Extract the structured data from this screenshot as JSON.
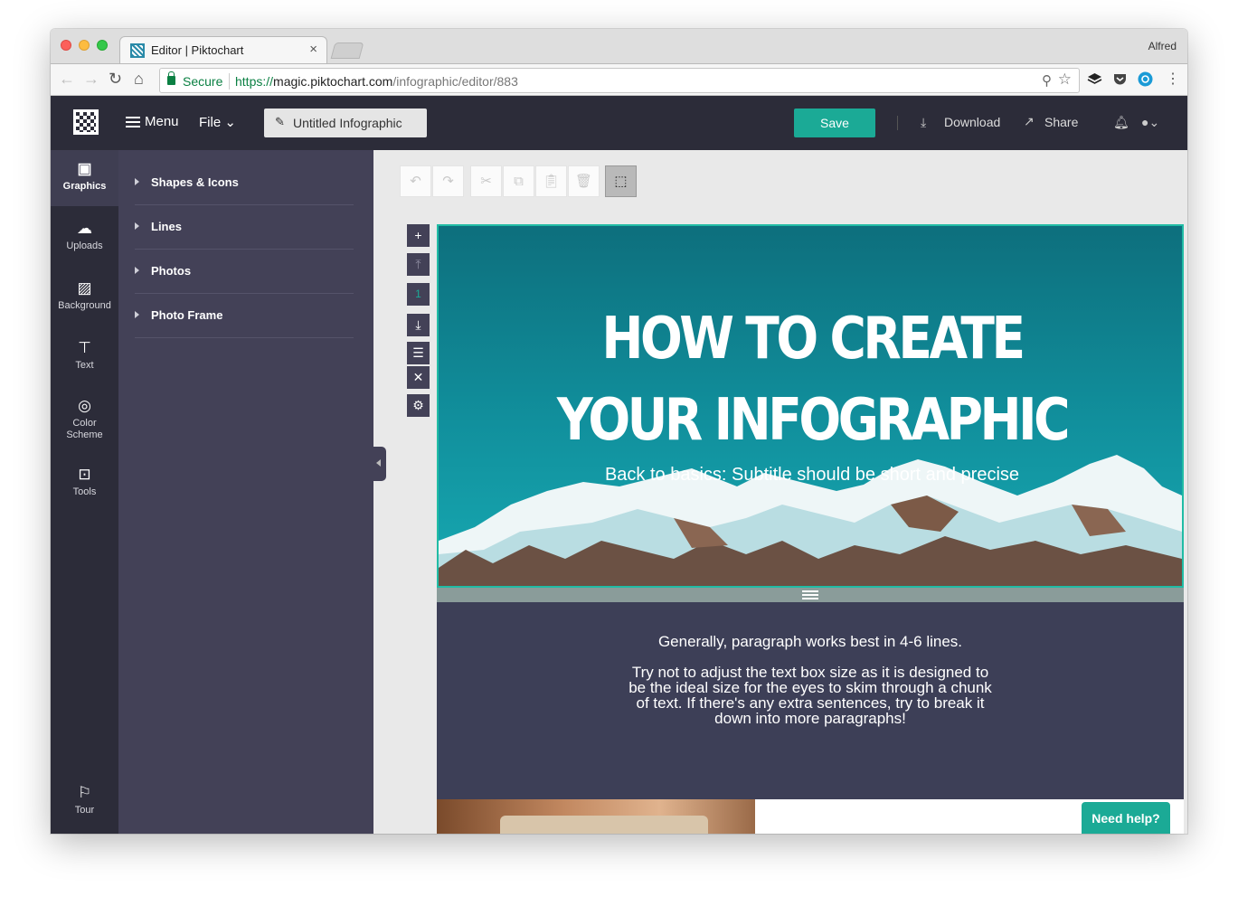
{
  "browser": {
    "tab_title": "Editor | Piktochart",
    "tab_close": "×",
    "profile_name": "Alfred",
    "secure_label": "Secure",
    "url_scheme": "https://",
    "url_host": "magic.piktochart.com",
    "url_path": "/infographic/editor/883"
  },
  "header": {
    "menu_label": "Menu",
    "file_label": "File ⌄",
    "doc_title": "Untitled Infographic",
    "save_label": "Save",
    "download_label": "Download",
    "share_label": "Share",
    "accent_color": "#1baa96",
    "bg_color": "#2c2c39"
  },
  "leftnav": {
    "items": [
      {
        "label": "Graphics",
        "icon": "image-icon",
        "active": true
      },
      {
        "label": "Uploads",
        "icon": "cloud-upload-icon"
      },
      {
        "label": "Background",
        "icon": "hatch-icon"
      },
      {
        "label": "Text",
        "icon": "text-box-icon"
      },
      {
        "label": "Color Scheme",
        "icon": "palette-icon"
      },
      {
        "label": "Tools",
        "icon": "toolbox-icon"
      }
    ],
    "tour_label": "Tour"
  },
  "panel": {
    "items": [
      "Shapes & Icons",
      "Lines",
      "Photos",
      "Photo Frame"
    ]
  },
  "side_tools": {
    "block_number": "1"
  },
  "infographic": {
    "title_line1": "HOW TO CREATE",
    "title_line2": "YOUR INFOGRAPHIC",
    "subtitle": "Back to basics: Subtitle should be short and precise",
    "para1": "Generally, paragraph works best in 4-6 lines.",
    "para2": "Try not to adjust the text box size as it is designed to be the ideal size for the eyes to skim through a chunk of text. If there's any extra sentences, try to break it down into more paragraphs!",
    "body_bg": "#3d3f57"
  },
  "help_label": "Need help?"
}
